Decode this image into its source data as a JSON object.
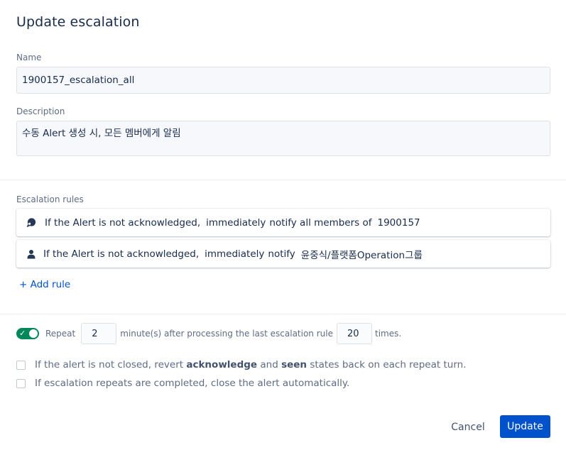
{
  "dialog": {
    "title": "Update escalation"
  },
  "name": {
    "label": "Name",
    "value": "1900157_escalation_all"
  },
  "description": {
    "label": "Description",
    "value": "수동 Alert 생성 시, 모든 멤버에게 알림"
  },
  "rules": {
    "label": "Escalation rules",
    "items": [
      {
        "icon": "team-icon",
        "condition": "If the Alert is not acknowledged,",
        "timing": "immediately",
        "action": "notify all members of",
        "target": "1900157"
      },
      {
        "icon": "user-icon",
        "condition": "If the Alert is not acknowledged,",
        "timing": "immediately",
        "action": "notify",
        "target": "윤중식/플랫폼Operation그룹"
      }
    ],
    "add_label": "+ Add rule"
  },
  "repeat": {
    "enabled": true,
    "label": "Repeat",
    "interval": "2",
    "interval_suffix": "minute(s) after processing the last escalation rule",
    "times": "20",
    "times_suffix": "times."
  },
  "options": {
    "revert_part1": "If the alert is not closed, revert",
    "revert_bold1": "acknowledge",
    "revert_part2": "and",
    "revert_bold2": "seen",
    "revert_part3": "states back on each repeat turn.",
    "close_label": "If escalation repeats are completed, close the alert automatically."
  },
  "footer": {
    "cancel_label": "Cancel",
    "update_label": "Update"
  },
  "colors": {
    "primary": "#0052cc",
    "toggle_on": "#00875a",
    "text": "#172b4d",
    "muted": "#5e6c84"
  }
}
